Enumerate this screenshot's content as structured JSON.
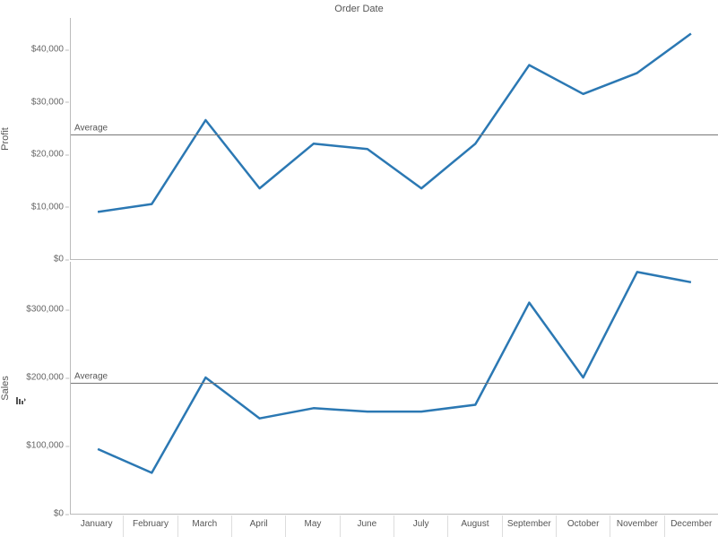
{
  "title": "Order Date",
  "months": [
    "January",
    "February",
    "March",
    "April",
    "May",
    "June",
    "July",
    "August",
    "September",
    "October",
    "November",
    "December"
  ],
  "panels": {
    "profit": {
      "ylabel": "Profit",
      "ticks": [
        0,
        10000,
        20000,
        30000,
        40000
      ],
      "tick_labels": [
        "$0",
        "$10,000",
        "$20,000",
        "$30,000",
        "$40,000"
      ],
      "ymax": 46000,
      "ref": {
        "label": "Average",
        "value": 23700
      }
    },
    "sales": {
      "ylabel": "Sales",
      "ticks": [
        0,
        100000,
        200000,
        300000
      ],
      "tick_labels": [
        "$0",
        "$100,000",
        "$200,000",
        "$300,000"
      ],
      "ymax": 370000,
      "ref": {
        "label": "Average",
        "value": 192000
      }
    }
  },
  "line_color": "#2b78b3",
  "chart_data": [
    {
      "type": "line",
      "title": "Profit by Order Date Month",
      "xlabel": "Order Date",
      "ylabel": "Profit",
      "ylim": [
        0,
        46000
      ],
      "reference_lines": [
        {
          "label": "Average",
          "value": 23700
        }
      ],
      "categories": [
        "January",
        "February",
        "March",
        "April",
        "May",
        "June",
        "July",
        "August",
        "September",
        "October",
        "November",
        "December"
      ],
      "series": [
        {
          "name": "Profit",
          "values": [
            9000,
            10500,
            26500,
            13500,
            22000,
            21000,
            13500,
            22000,
            37000,
            31500,
            35500,
            43000
          ]
        }
      ]
    },
    {
      "type": "line",
      "title": "Sales by Order Date Month",
      "xlabel": "Order Date",
      "ylabel": "Sales",
      "ylim": [
        0,
        370000
      ],
      "reference_lines": [
        {
          "label": "Average",
          "value": 192000
        }
      ],
      "categories": [
        "January",
        "February",
        "March",
        "April",
        "May",
        "June",
        "July",
        "August",
        "September",
        "October",
        "November",
        "December"
      ],
      "series": [
        {
          "name": "Sales",
          "values": [
            95000,
            60000,
            200000,
            140000,
            155000,
            150000,
            150000,
            160000,
            310000,
            200000,
            355000,
            340000
          ]
        }
      ]
    }
  ]
}
